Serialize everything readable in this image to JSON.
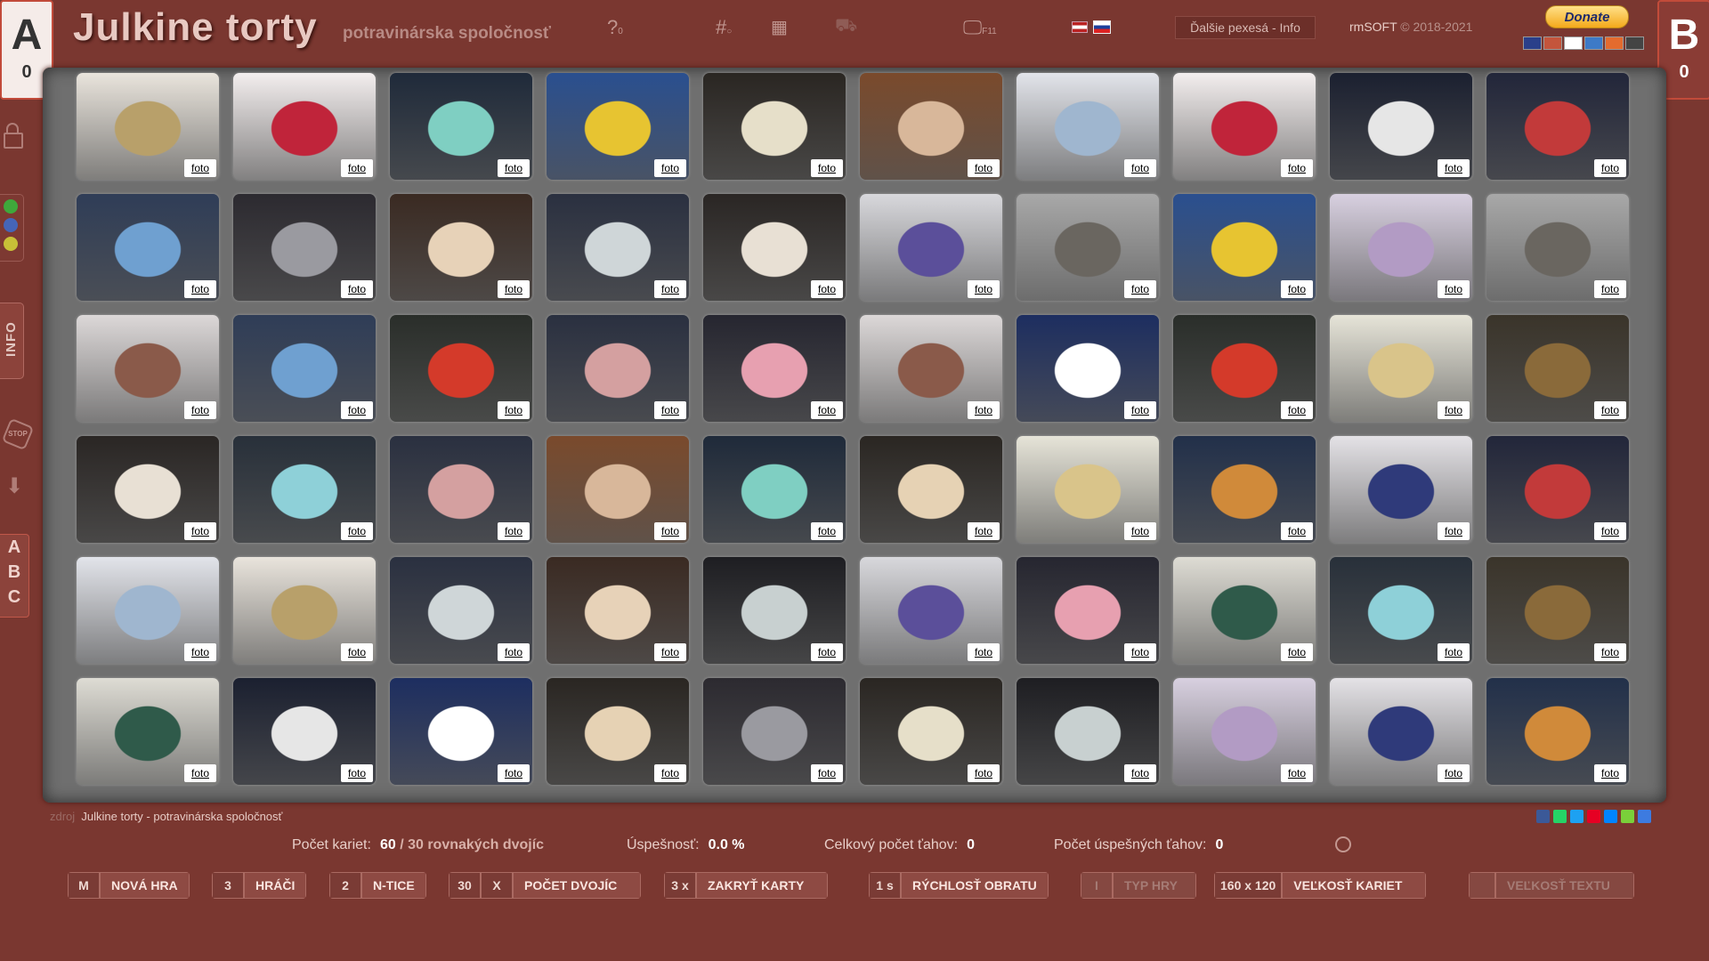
{
  "header": {
    "title": "Julkine torty",
    "subtitle": "potravinárska spoločnosť",
    "icon_help": "?",
    "icon_help_sub": "0",
    "icon_hash": "#",
    "icon_fullscreen_sub": "F11",
    "info_button": "Ďalšie pexesá - Info",
    "copyright_brand": "rmSOFT",
    "copyright_years": "© 2018-2021",
    "donate": "Donate"
  },
  "players": [
    {
      "letter": "A",
      "score": "0"
    },
    {
      "letter": "B",
      "score": "0"
    }
  ],
  "sidebar": {
    "colors": [
      "#3fa83b",
      "#4565b8",
      "#c8c037"
    ],
    "info": "INFO",
    "stop": "STOP",
    "abc": [
      "A",
      "B",
      "C"
    ]
  },
  "board": {
    "foto_label": "foto",
    "cards": [
      {
        "c": "#e9e4dc",
        "a": "#b8a06a"
      },
      {
        "c": "#f3eeee",
        "a": "#c0243a"
      },
      {
        "c": "#1f2a3a",
        "a": "#7fcfc2"
      },
      {
        "c": "#2a4f8f",
        "a": "#e7c431"
      },
      {
        "c": "#2a2622",
        "a": "#e6dfc9"
      },
      {
        "c": "#7a4a2c",
        "a": "#d8b79a"
      },
      {
        "c": "#e2e4ea",
        "a": "#9fb6cf"
      },
      {
        "c": "#f3eeee",
        "a": "#c0243a"
      },
      {
        "c": "#1b2030",
        "a": "#e6e6e6"
      },
      {
        "c": "#22263a",
        "a": "#c23a3a"
      },
      {
        "c": "#2f3d57",
        "a": "#6fa0d0"
      },
      {
        "c": "#2c2a30",
        "a": "#9a9aa0"
      },
      {
        "c": "#3a2a22",
        "a": "#e7d2b8"
      },
      {
        "c": "#2a3040",
        "a": "#cfd6d8"
      },
      {
        "c": "#2a2624",
        "a": "#e8e0d4"
      },
      {
        "c": "#d8d8dc",
        "a": "#5b4f9a"
      },
      {
        "c": "#a8a8a8",
        "a": "#6a6660"
      },
      {
        "c": "#2a4f8f",
        "a": "#e7c431"
      },
      {
        "c": "#d8d0e0",
        "a": "#b29bc4"
      },
      {
        "c": "#a8a8a8",
        "a": "#6a6660"
      },
      {
        "c": "#dcd8d8",
        "a": "#8a5a4a"
      },
      {
        "c": "#2f3d57",
        "a": "#6fa0d0"
      },
      {
        "c": "#2a2e2a",
        "a": "#d43a2a"
      },
      {
        "c": "#2a3040",
        "a": "#d4a0a0"
      },
      {
        "c": "#262630",
        "a": "#e7a0b0"
      },
      {
        "c": "#dcd8d8",
        "a": "#8a5a4a"
      },
      {
        "c": "#1d2e60",
        "a": "#ffffff"
      },
      {
        "c": "#2a2e2a",
        "a": "#d43a2a"
      },
      {
        "c": "#e6e4d8",
        "a": "#d9c48a"
      },
      {
        "c": "#3a342a",
        "a": "#8a6a3a"
      },
      {
        "c": "#2a2624",
        "a": "#e8e0d4"
      },
      {
        "c": "#28303a",
        "a": "#8ed0d8"
      },
      {
        "c": "#2a3040",
        "a": "#d4a0a0"
      },
      {
        "c": "#7a4a2c",
        "a": "#d8b79a"
      },
      {
        "c": "#1f2a3a",
        "a": "#7fcfc2"
      },
      {
        "c": "#2a2622",
        "a": "#e6d2b4"
      },
      {
        "c": "#e6e4d8",
        "a": "#d9c48a"
      },
      {
        "c": "#22304a",
        "a": "#d08a3a"
      },
      {
        "c": "#e4e2e6",
        "a": "#2f3a7a"
      },
      {
        "c": "#22263a",
        "a": "#c23a3a"
      },
      {
        "c": "#e2e4ea",
        "a": "#9fb6cf"
      },
      {
        "c": "#e9e4dc",
        "a": "#b8a06a"
      },
      {
        "c": "#2a3040",
        "a": "#cfd6d8"
      },
      {
        "c": "#3a2a22",
        "a": "#e7d2b8"
      },
      {
        "c": "#1e1e22",
        "a": "#c8d0d0"
      },
      {
        "c": "#d8d8dc",
        "a": "#5b4f9a"
      },
      {
        "c": "#262630",
        "a": "#e7a0b0"
      },
      {
        "c": "#dedcd4",
        "a": "#2f5a4a"
      },
      {
        "c": "#28303a",
        "a": "#8ed0d8"
      },
      {
        "c": "#3a342a",
        "a": "#8a6a3a"
      },
      {
        "c": "#dedcd4",
        "a": "#2f5a4a"
      },
      {
        "c": "#1b2030",
        "a": "#e6e6e6"
      },
      {
        "c": "#1d2e60",
        "a": "#ffffff"
      },
      {
        "c": "#2a2622",
        "a": "#e6d2b4"
      },
      {
        "c": "#2c2a30",
        "a": "#9a9aa0"
      },
      {
        "c": "#2a2622",
        "a": "#e6dfc9"
      },
      {
        "c": "#1e1e22",
        "a": "#c8d0d0"
      },
      {
        "c": "#d8d0e0",
        "a": "#b29bc4"
      },
      {
        "c": "#e4e2e6",
        "a": "#2f3a7a"
      },
      {
        "c": "#22304a",
        "a": "#d08a3a"
      }
    ]
  },
  "footer": {
    "source_prefix": "zdroj",
    "source_name": "Julkine torty - potravinárska spoločnosť",
    "share_colors": [
      "#3b5998",
      "#25d366",
      "#1da1f2",
      "#e60023",
      "#0084ff",
      "#7ad03a",
      "#3d7be0"
    ]
  },
  "stats": {
    "cards_label": "Počet kariet:",
    "cards_value": "60",
    "pairs_value": "/ 30",
    "pairs_label": "rovnakých dvojíc",
    "success_label": "Úspešnosť:",
    "success_value": "0.0 %",
    "moves_label": "Celkový počet ťahov:",
    "moves_value": "0",
    "good_moves_label": "Počet úspešných ťahov:",
    "good_moves_value": "0"
  },
  "controls": [
    {
      "key": "M",
      "label": "NOVÁ HRA"
    },
    {
      "key": "3",
      "label": "HRÁČI"
    },
    {
      "key": "2",
      "label": "N-TICE"
    },
    {
      "key": "30",
      "key2": "X",
      "label": "POČET DVOJÍC"
    },
    {
      "key": "3 x",
      "label": "ZAKRYŤ KARTY"
    },
    {
      "key": "1 s",
      "label": "RÝCHLOSŤ OBRATU"
    },
    {
      "key": "I",
      "label": "TYP HRY"
    },
    {
      "key": "160 x 120",
      "label": "VEĽKOSŤ KARIET"
    },
    {
      "key": "",
      "label": "VEĽKOSŤ TEXTU"
    }
  ]
}
